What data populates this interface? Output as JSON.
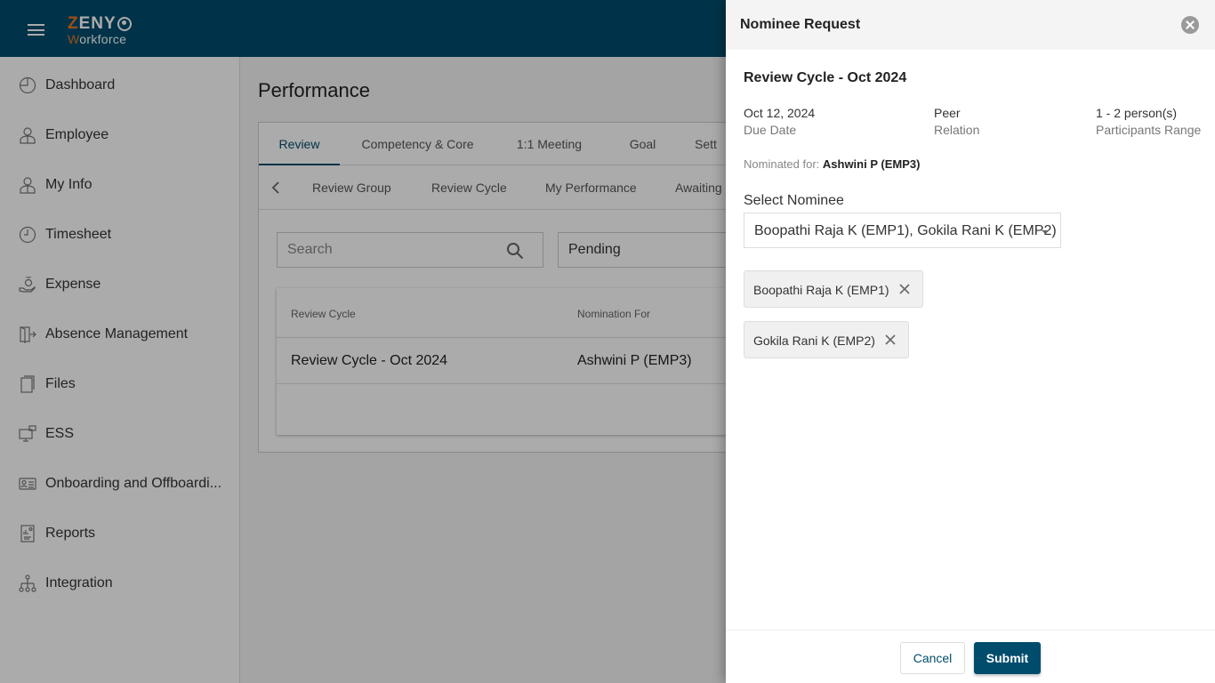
{
  "app": {
    "logo_line1": "ZENY",
    "logo_line2": "Workforce",
    "brand_color": "#004c6d",
    "accent_color": "#e87722"
  },
  "sidebar": {
    "items": [
      {
        "label": "Dashboard",
        "icon": "dashboard-icon"
      },
      {
        "label": "Employee",
        "icon": "employee-icon"
      },
      {
        "label": "My Info",
        "icon": "my-info-icon"
      },
      {
        "label": "Timesheet",
        "icon": "clock-icon"
      },
      {
        "label": "Expense",
        "icon": "expense-icon"
      },
      {
        "label": "Absence Management",
        "icon": "exit-door-icon"
      },
      {
        "label": "Files",
        "icon": "files-icon"
      },
      {
        "label": "ESS",
        "icon": "ess-icon"
      },
      {
        "label": "Onboarding and Offboardi...",
        "icon": "id-card-icon"
      },
      {
        "label": "Reports",
        "icon": "reports-icon"
      },
      {
        "label": "Integration",
        "icon": "integration-icon"
      }
    ]
  },
  "main": {
    "title": "Performance",
    "tabs": [
      {
        "label": "Review",
        "active": true
      },
      {
        "label": "Competency & Core",
        "active": false
      },
      {
        "label": "1:1 Meeting",
        "active": false
      },
      {
        "label": "Goal",
        "active": false
      },
      {
        "label": "Sett",
        "active": false
      }
    ],
    "subtabs": [
      {
        "label": "Review Group"
      },
      {
        "label": "Review Cycle"
      },
      {
        "label": "My Performance"
      },
      {
        "label": "Awaiting"
      }
    ],
    "search": {
      "placeholder": "Search",
      "value": ""
    },
    "status_filter": {
      "selected": "Pending"
    },
    "table": {
      "columns": [
        "Review Cycle",
        "Nomination For"
      ],
      "rows": [
        {
          "review_cycle": "Review Cycle - Oct 2024",
          "nomination_for": "Ashwini P (EMP3)"
        }
      ]
    }
  },
  "drawer": {
    "title": "Nominee Request",
    "cycle_title": "Review Cycle - Oct 2024",
    "meta": [
      {
        "value": "Oct 12, 2024",
        "label": "Due Date"
      },
      {
        "value": "Peer",
        "label": "Relation"
      },
      {
        "value": "1 - 2 person(s)",
        "label": "Participants Range"
      }
    ],
    "nominated_for_label": "Nominated for:",
    "nominated_for_value": "Ashwini P (EMP3)",
    "select_label": "Select Nominee",
    "select_value": "Boopathi Raja K (EMP1), Gokila Rani K (EMP2)",
    "chips": [
      {
        "label": "Boopathi Raja K (EMP1)"
      },
      {
        "label": "Gokila Rani K (EMP2)"
      }
    ],
    "cancel_label": "Cancel",
    "submit_label": "Submit"
  }
}
